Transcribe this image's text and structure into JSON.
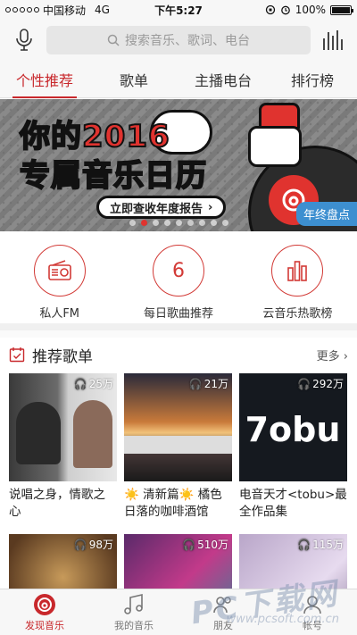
{
  "status": {
    "carrier": "中国移动",
    "network": "4G",
    "time": "下午5:27",
    "battery": "100%"
  },
  "search": {
    "placeholder": "搜索音乐、歌词、电台"
  },
  "tabs": [
    {
      "label": "个性推荐",
      "active": true
    },
    {
      "label": "歌单",
      "active": false
    },
    {
      "label": "主播电台",
      "active": false
    },
    {
      "label": "排行榜",
      "active": false
    }
  ],
  "banner": {
    "line1": "你的2016",
    "line2": "专属音乐日历",
    "cta": "立即查收年度报告",
    "badge": "年终盘点",
    "page_count": 9,
    "active_page": 1
  },
  "shortcuts": [
    {
      "label": "私人FM",
      "icon": "radio-icon"
    },
    {
      "label": "每日歌曲推荐",
      "icon": "calendar-day-icon",
      "value": "6"
    },
    {
      "label": "云音乐热歌榜",
      "icon": "chart-bars-icon"
    }
  ],
  "section": {
    "title": "推荐歌单",
    "more": "更多"
  },
  "playlists": [
    {
      "count": "25万",
      "caption": "说唱之身，情歌之心"
    },
    {
      "count": "21万",
      "caption": "☀️ 清新篇☀️ 橘色日落的咖啡酒馆"
    },
    {
      "count": "292万",
      "caption": "电音天才<tobu>最全作品集"
    },
    {
      "count": "98万",
      "caption": ""
    },
    {
      "count": "510万",
      "caption": ""
    },
    {
      "count": "115万",
      "caption": ""
    }
  ],
  "tabbar": [
    {
      "label": "发现音乐",
      "active": true
    },
    {
      "label": "我的音乐",
      "active": false
    },
    {
      "label": "朋友",
      "active": false
    },
    {
      "label": "帐号",
      "active": false
    }
  ],
  "watermark": {
    "text": "PC下载网",
    "url": "www.pcsoft.com.cn"
  },
  "colors": {
    "accent": "#c8282c",
    "badge": "#3d8fd0"
  }
}
